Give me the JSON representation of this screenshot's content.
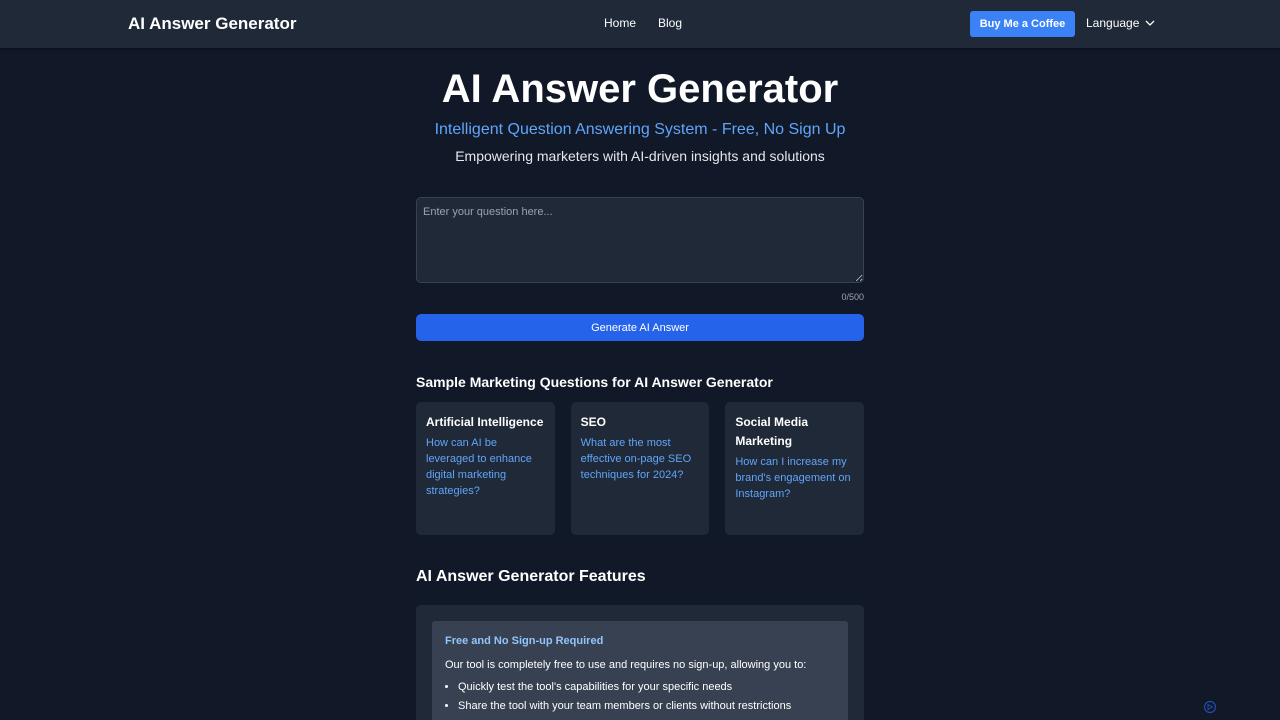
{
  "nav": {
    "brand": "AI Answer Generator",
    "links": [
      "Home",
      "Blog"
    ],
    "coffee_button": "Buy Me a Coffee",
    "language": "Language"
  },
  "hero": {
    "title": "AI Answer Generator",
    "subtitle": "Intelligent Question Answering System - Free, No Sign Up",
    "description": "Empowering marketers with AI-driven insights and solutions"
  },
  "form": {
    "placeholder": "Enter your question here...",
    "counter": "0/500",
    "generate_button": "Generate AI Answer"
  },
  "samples": {
    "heading": "Sample Marketing Questions for AI Answer Generator",
    "cards": [
      {
        "title": "Artificial Intelligence",
        "question": "How can AI be leveraged to enhance digital marketing strategies?"
      },
      {
        "title": "SEO",
        "question": "What are the most effective on-page SEO techniques for 2024?"
      },
      {
        "title": "Social Media Marketing",
        "question": "How can I increase my brand's engagement on Instagram?"
      }
    ]
  },
  "features": {
    "heading": "AI Answer Generator Features",
    "item_title": "Free and No Sign-up Required",
    "item_text": "Our tool is completely free to use and requires no sign-up, allowing you to:",
    "bullets": [
      "Quickly test the tool's capabilities for your specific needs",
      "Share the tool with your team members or clients without restrictions"
    ]
  },
  "colors": {
    "background": "#111827",
    "navbar": "#1f2937",
    "accent": "#3b82f6",
    "primary_button": "#2563eb",
    "link_blue": "#60a5fa"
  },
  "icons": {
    "language_dropdown": "chevron-down-icon",
    "corner": "refresh-icon"
  }
}
